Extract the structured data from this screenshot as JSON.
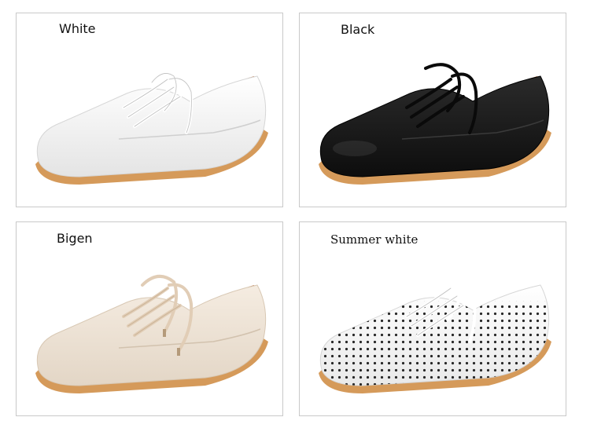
{
  "panels": [
    {
      "label": "White",
      "color": "#f4f4f4",
      "laces": "#ffffff",
      "variant": "plain"
    },
    {
      "label": "Black",
      "color": "#151515",
      "laces": "#0a0a0a",
      "variant": "plain"
    },
    {
      "label": "Bigen",
      "color": "#eee3d6",
      "laces": "#e1cdb6",
      "variant": "plain"
    },
    {
      "label": "Summer white",
      "color": "#fafafa",
      "laces": "#ffffff",
      "variant": "perforated"
    }
  ],
  "sole_color": "#d59a5a",
  "lining_color": "#b5652f"
}
